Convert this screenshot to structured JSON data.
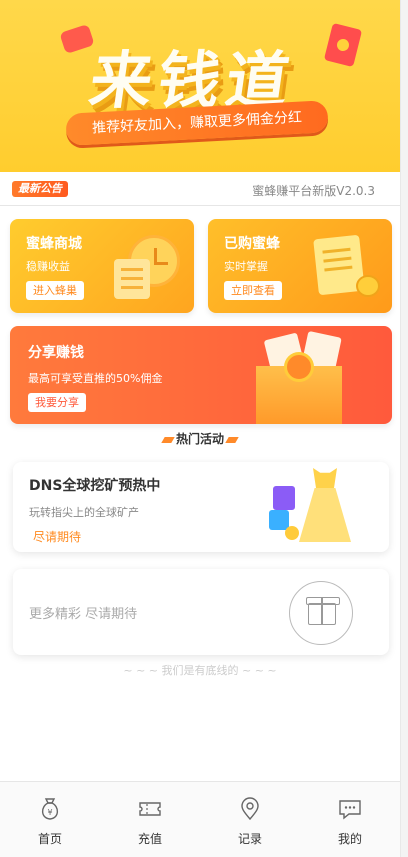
{
  "banner": {
    "title": "来钱道",
    "slogan": "推荐好友加入，赚取更多佣金分红"
  },
  "notice": {
    "tag": "最新公告",
    "text": "蜜蜂赚平台新版V2.0.3"
  },
  "cards": {
    "mall": {
      "title": "蜜蜂商城",
      "sub": "稳赚收益",
      "button": "进入蜂巢"
    },
    "bought": {
      "title": "已购蜜蜂",
      "sub": "实时掌握",
      "button": "立即查看"
    },
    "share": {
      "title": "分享赚钱",
      "sub": "最高可享受直推的50%佣金",
      "button": "我要分享"
    }
  },
  "section": {
    "title": "热门活动"
  },
  "activity": {
    "title": "DNS全球挖矿预热中",
    "sub": "玩转指尖上的全球矿产",
    "status": "尽请期待"
  },
  "more": {
    "text": "更多精彩 尽请期待"
  },
  "footer": {
    "text": "~ ~ ~ 我们是有底线的 ~ ~ ~"
  },
  "tabbar": {
    "items": [
      {
        "label": "首页",
        "icon": "money-bag-icon"
      },
      {
        "label": "充值",
        "icon": "ticket-icon"
      },
      {
        "label": "记录",
        "icon": "location-icon"
      },
      {
        "label": "我的",
        "icon": "chat-icon"
      }
    ]
  },
  "colors": {
    "accent": "#ff8a1f",
    "banner": "#ffd84a",
    "share": "#ff5a3c"
  }
}
